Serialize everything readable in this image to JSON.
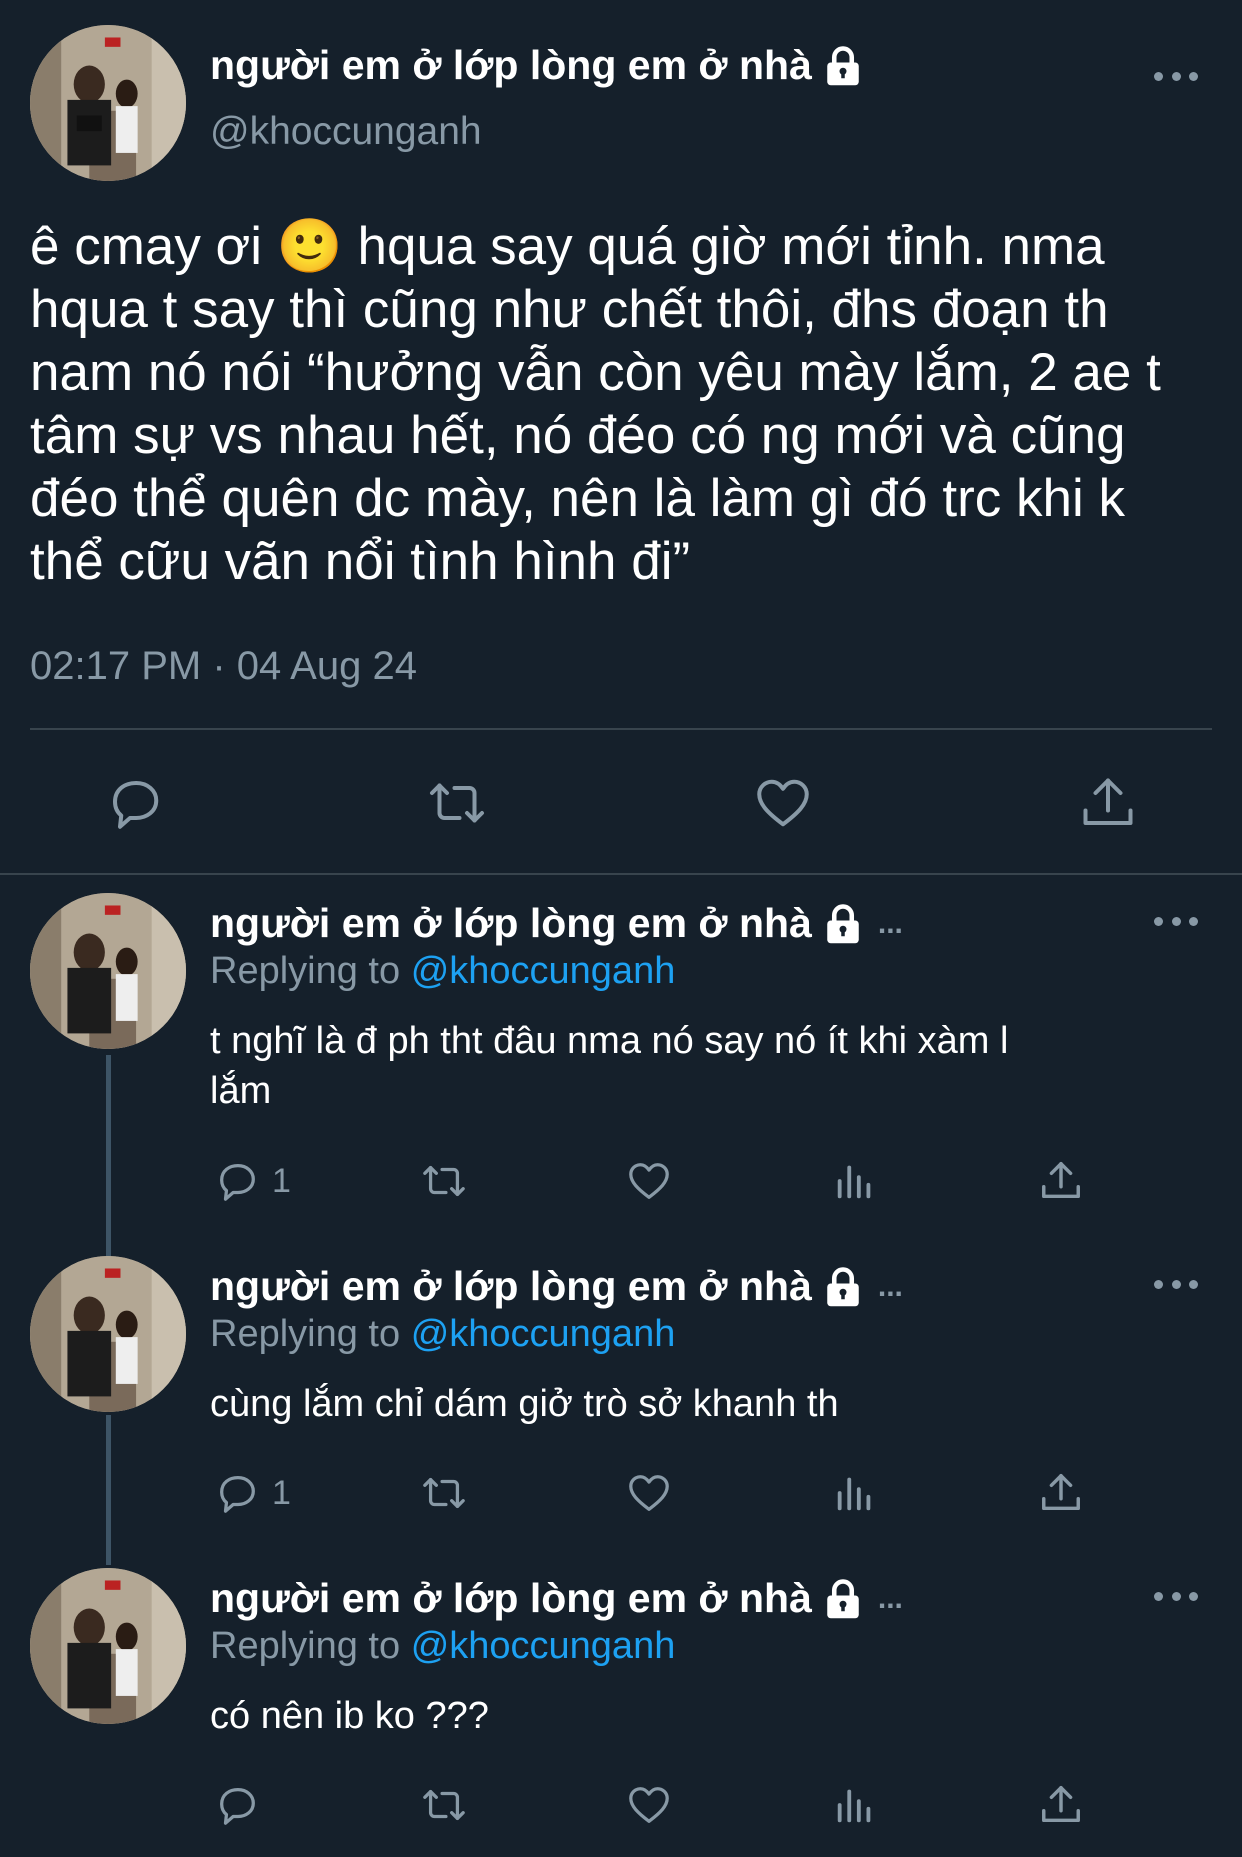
{
  "main_tweet": {
    "display_name": "người em ở lớp lòng em ở nhà",
    "handle": "@khoccunganh",
    "text_lines": [
      "ê cmay ơi 🙂  hqua say quá giờ mới tỉnh. nma",
      "hqua t say thì cũng như chết thôi, đhs đoạn th",
      "nam nó nói “hưởng vẫn còn yêu mày lắm, 2 ae t",
      "tâm sự vs nhau hết, nó đéo có ng mới và cũng",
      "đéo thể quên dc mày, nên là làm gì đó trc khi k",
      "thể cữu vãn nổi tình hình đi”"
    ],
    "timestamp": "02:17 PM · 04 Aug 24"
  },
  "replies": [
    {
      "display_name": "người em ở lớp lòng em ở nhà",
      "truncation": "...",
      "replying_label": "Replying to",
      "replying_to": "@khoccunganh",
      "text_lines": [
        "t nghĩ là đ ph tht đâu nma nó say nó ít khi xàm l",
        "lắm"
      ],
      "reply_count": "1"
    },
    {
      "display_name": "người em ở lớp lòng em ở nhà",
      "truncation": "...",
      "replying_label": "Replying to",
      "replying_to": "@khoccunganh",
      "text_lines": [
        "cùng lắm chỉ dám giở trò sở khanh th"
      ],
      "reply_count": "1"
    },
    {
      "display_name": "người em ở lớp lòng em ở nhà",
      "truncation": "...",
      "replying_label": "Replying to",
      "replying_to": "@khoccunganh",
      "text_lines": [
        "có nên ib ko ???"
      ],
      "reply_count": ""
    }
  ],
  "icons": {
    "reply": "reply-icon",
    "retweet": "retweet-icon",
    "like": "heart-icon",
    "share": "share-icon",
    "analytics": "analytics-icon",
    "more": "more-icon",
    "lock": "lock-icon"
  },
  "colors": {
    "background": "#15202b",
    "secondary_text": "#8899a6",
    "mention": "#1da1f2",
    "divider": "#38444d"
  }
}
